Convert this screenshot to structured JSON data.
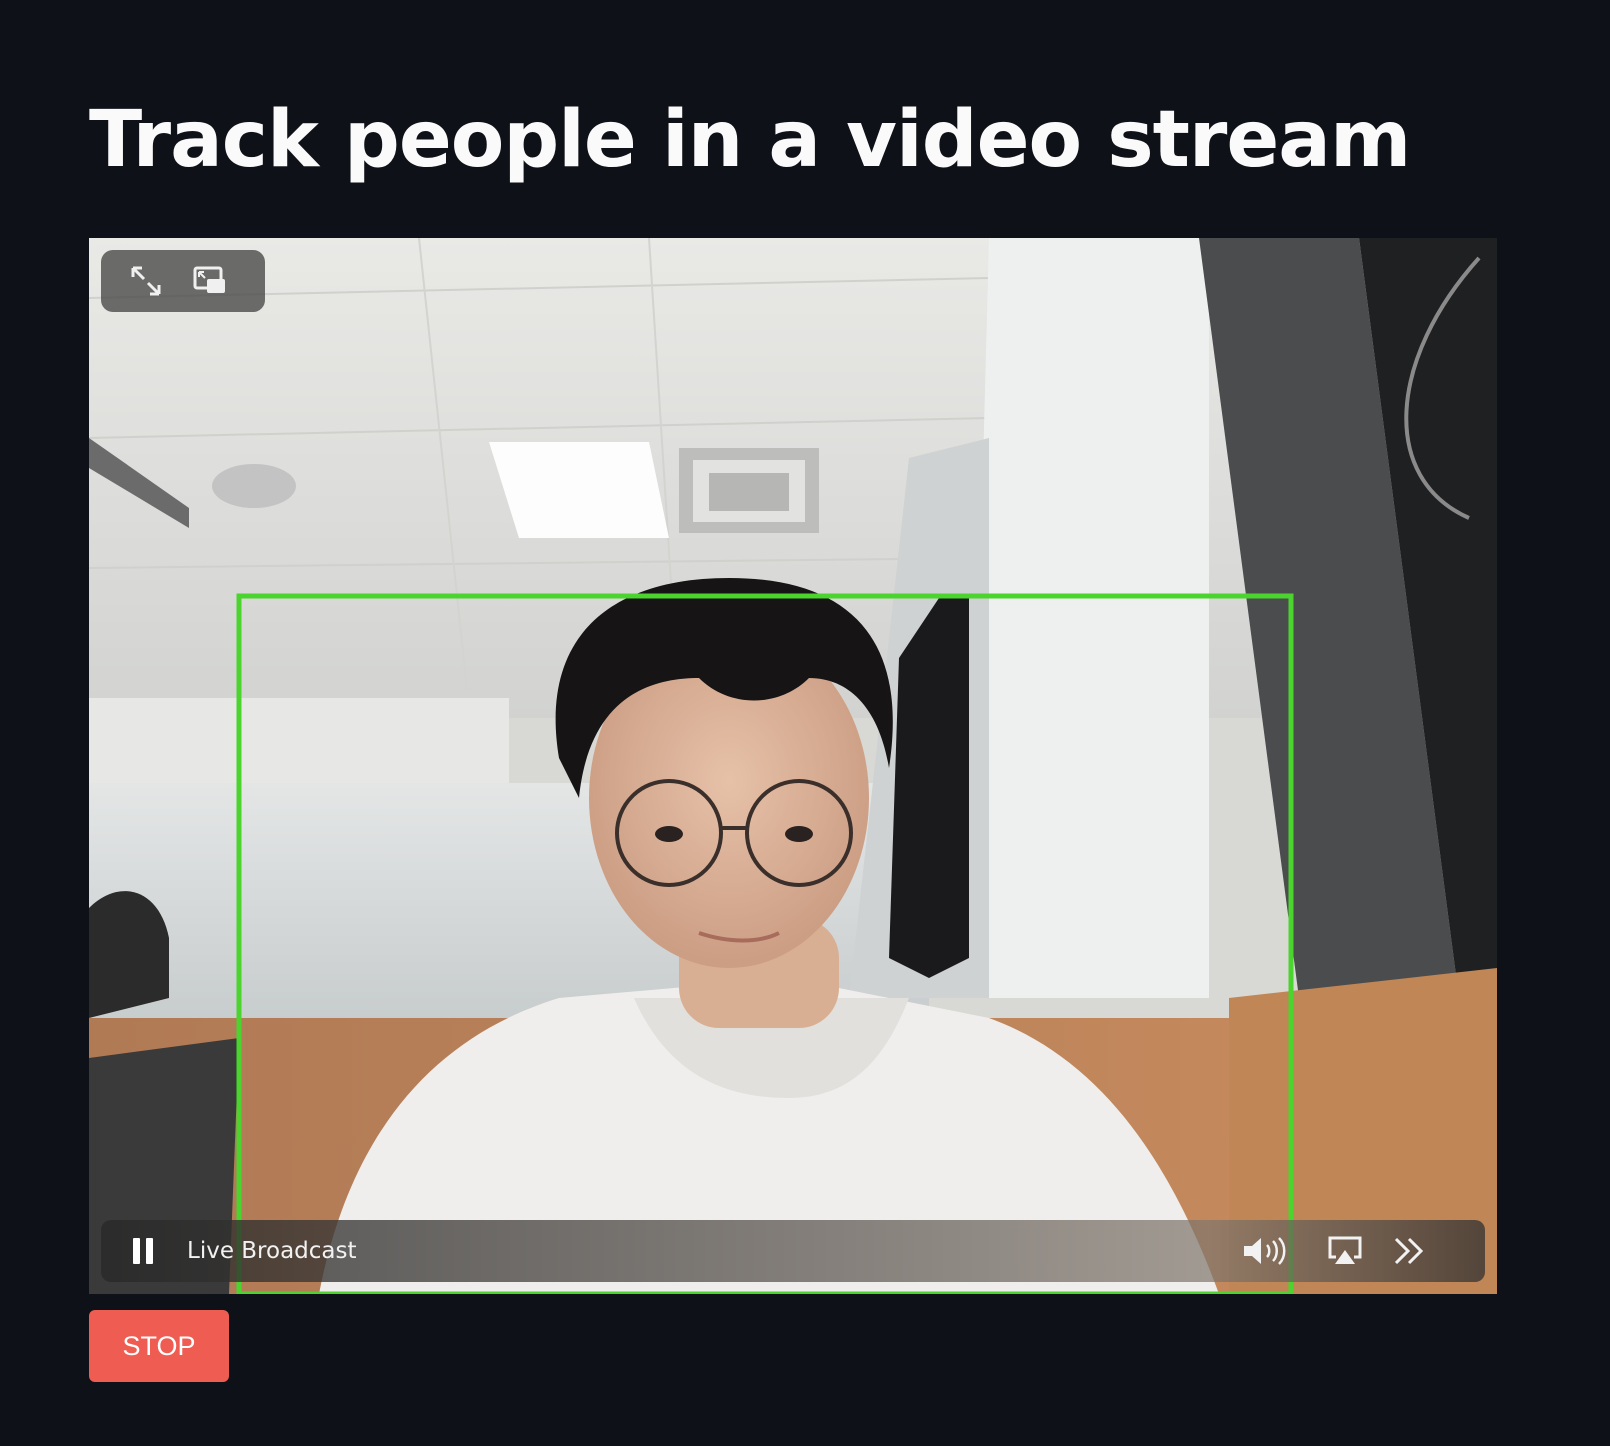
{
  "page": {
    "title": "Track people in a video stream"
  },
  "video": {
    "status_label": "Live Broadcast",
    "detection_box_color": "#4bd42e",
    "top_controls": [
      "fullscreen-icon",
      "picture-in-picture-icon"
    ],
    "bottom_controls": [
      "pause-icon",
      "volume-icon",
      "airplay-icon",
      "more-icon"
    ]
  },
  "controls": {
    "stop_label": "STOP",
    "stop_color": "#ee5c52"
  },
  "theme": {
    "background": "#0e1117",
    "text": "#fafafa"
  }
}
